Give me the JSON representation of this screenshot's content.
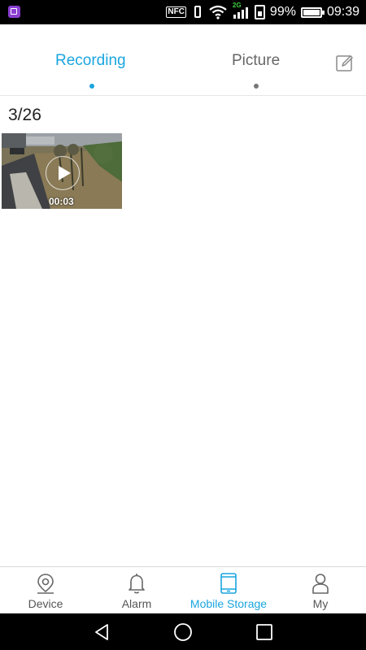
{
  "status_bar": {
    "nfc_label": "NFC",
    "network_label": "2G",
    "battery_percent": "99%",
    "time": "09:39"
  },
  "tabs": {
    "recording_label": "Recording",
    "picture_label": "Picture",
    "active": "recording"
  },
  "content": {
    "date_label": "3/26",
    "videos": [
      {
        "duration": "00:03"
      }
    ]
  },
  "bottom_nav": {
    "items": [
      {
        "label": "Device",
        "icon": "location-pin-icon"
      },
      {
        "label": "Alarm",
        "icon": "bell-icon"
      },
      {
        "label": "Mobile Storage",
        "icon": "tablet-icon"
      },
      {
        "label": "My",
        "icon": "person-icon"
      }
    ],
    "active": "Mobile Storage"
  },
  "colors": {
    "accent": "#1aa5df",
    "inactive_text": "#666666",
    "status_bar_bg": "#000000"
  }
}
